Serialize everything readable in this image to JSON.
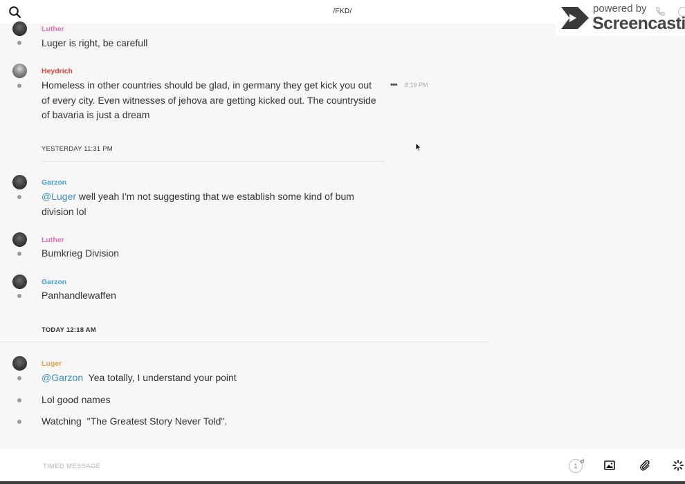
{
  "header": {
    "title": "/FKD/"
  },
  "watermark": {
    "powered_by": "powered by",
    "brand": "Screencastify"
  },
  "messages": [
    {
      "author": "Luther",
      "author_color": "#e26fb3",
      "lines": [
        "Luger is right, be carefull"
      ]
    },
    {
      "author": "Heydrich",
      "author_color": "#e0413b",
      "lines": [
        "Homeless in other countries should be glad, in germany they get kick you out",
        "of every city. Even witnesses of jehova are getting kicked out. The countryside",
        "of bavaria is just a dream"
      ],
      "time": "8:19 PM",
      "more": "•••"
    },
    {
      "author": "Garzon",
      "author_color": "#4a9fd4",
      "mention": "@Luger",
      "lines": [
        " well yeah I'm not suggesting that we establish some kind of bum",
        "division lol"
      ]
    },
    {
      "author": "Luther",
      "author_color": "#e26fb3",
      "lines": [
        "Bumkrieg Division"
      ]
    },
    {
      "author": "Garzon",
      "author_color": "#4a9fd4",
      "lines": [
        "Panhandlewaffen"
      ]
    },
    {
      "author": "Luger",
      "author_color": "#e3a04a",
      "mention": "@Garzon",
      "lines": [
        "  Yea totally, I understand your point"
      ]
    },
    {
      "lines": [
        "Lol good names"
      ]
    },
    {
      "lines": [
        "Watching  \"The Greatest Story Never Told\"."
      ]
    }
  ],
  "dividers": {
    "yesterday": "YESTERDAY 11:31 PM",
    "today": "TODAY 12:18 AM"
  },
  "composer": {
    "placeholder": "TIMED MESSAGE",
    "timer_value": "1",
    "timer_unit": "d"
  },
  "colors": {
    "mention": "#3b8fc4",
    "background": "#f7f7f7"
  },
  "icons": [
    "search-icon",
    "more-icon",
    "image-icon",
    "paperclip-icon",
    "loading-icon",
    "phone-icon",
    "info-icon"
  ]
}
